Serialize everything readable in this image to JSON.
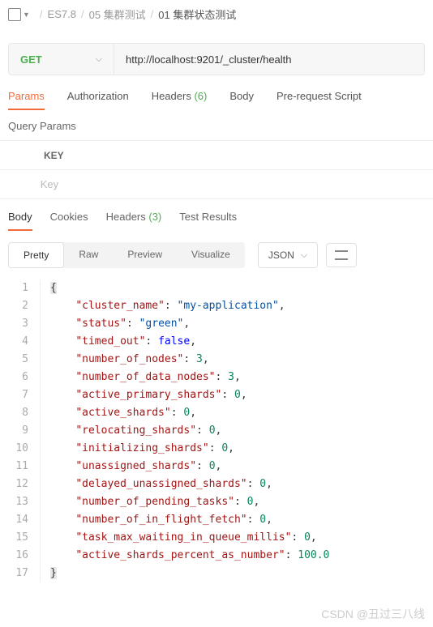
{
  "breadcrumb": {
    "parts": [
      "ES7.8",
      "05 集群测试",
      "01 集群状态测试"
    ]
  },
  "request": {
    "method": "GET",
    "url": "http://localhost:9201/_cluster/health"
  },
  "reqTabs": {
    "params": "Params",
    "auth": "Authorization",
    "headers": "Headers",
    "headersCount": "(6)",
    "body": "Body",
    "prereq": "Pre-request Script"
  },
  "queryParams": {
    "title": "Query Params",
    "keyHeader": "KEY",
    "keyPlaceholder": "Key"
  },
  "respTabs": {
    "body": "Body",
    "cookies": "Cookies",
    "headers": "Headers",
    "headersCount": "(3)",
    "tests": "Test Results"
  },
  "viewTabs": {
    "pretty": "Pretty",
    "raw": "Raw",
    "preview": "Preview",
    "visualize": "Visualize"
  },
  "format": {
    "label": "JSON"
  },
  "response": {
    "cluster_name": "my-application",
    "status": "green",
    "timed_out": false,
    "number_of_nodes": 3,
    "number_of_data_nodes": 3,
    "active_primary_shards": 0,
    "active_shards": 0,
    "relocating_shards": 0,
    "initializing_shards": 0,
    "unassigned_shards": 0,
    "delayed_unassigned_shards": 0,
    "number_of_pending_tasks": 0,
    "number_of_in_flight_fetch": 0,
    "task_max_waiting_in_queue_millis": 0,
    "active_shards_percent_as_number": 100.0
  },
  "watermark": "CSDN @丑过三八线"
}
